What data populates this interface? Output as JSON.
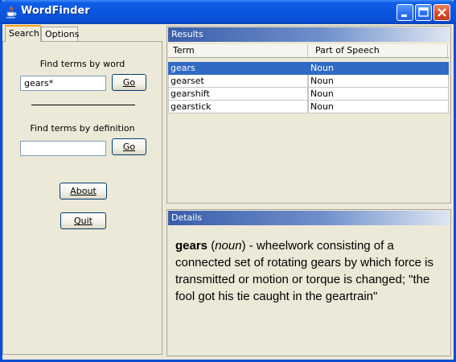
{
  "window": {
    "title": "WordFinder"
  },
  "tabs": [
    {
      "label": "Search",
      "active": true
    },
    {
      "label": "Options",
      "active": false
    }
  ],
  "search": {
    "word_label": "Find terms by word",
    "word_value": "gears*",
    "word_go": "Go",
    "definition_label": "Find terms by definition",
    "definition_value": "",
    "definition_go": "Go",
    "about": "About",
    "quit": "Quit"
  },
  "results": {
    "header": "Results",
    "columns": [
      "Term",
      "Part of Speech"
    ],
    "rows": [
      {
        "term": "gears",
        "pos": "Noun",
        "selected": true
      },
      {
        "term": "gearset",
        "pos": "Noun",
        "selected": false
      },
      {
        "term": "gearshift",
        "pos": "Noun",
        "selected": false
      },
      {
        "term": "gearstick",
        "pos": "Noun",
        "selected": false
      }
    ]
  },
  "details": {
    "header": "Details",
    "term": "gears",
    "pos": "noun",
    "definition": "wheelwork consisting of a connected set of rotating gears by which force is transmitted or motion or torque is changed; \"the fool got his tie caught in the geartrain\""
  },
  "icons": {
    "app": "java-cup-icon",
    "minimize": "minimize-icon",
    "maximize": "maximize-icon",
    "close": "close-icon"
  },
  "colors": {
    "titlebar": "#0a55df",
    "selection": "#316ac5",
    "header_gradient_start": "#3a5eaa"
  }
}
